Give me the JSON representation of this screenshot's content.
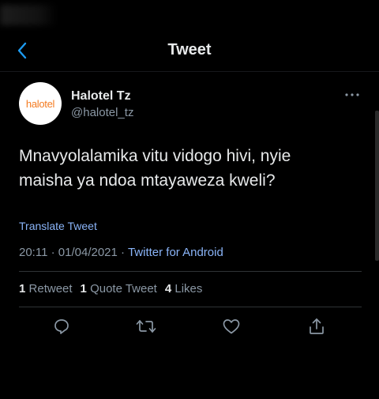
{
  "header": {
    "title": "Tweet",
    "back_icon": "chevron-left-icon"
  },
  "tweet": {
    "avatar_logo": "halotel",
    "display_name": "Halotel Tz",
    "handle": "@halotel_tz",
    "more_icon": "more-horizontal-icon",
    "text": "Mnavyolalamika vitu vidogo hivi, nyie\nmaisha ya ndoa mtayaweza kweli?",
    "translate_label": "Translate Tweet",
    "time": "20:11",
    "date": "01/04/2021",
    "separator": "·",
    "source": "Twitter for Android"
  },
  "stats": {
    "retweets_count": "1",
    "retweets_label": "Retweet",
    "quotes_count": "1",
    "quotes_label": "Quote Tweet",
    "likes_count": "4",
    "likes_label": "Likes"
  },
  "actions": [
    {
      "name": "reply",
      "icon": "reply-icon"
    },
    {
      "name": "retweet",
      "icon": "retweet-icon"
    },
    {
      "name": "like",
      "icon": "heart-icon"
    },
    {
      "name": "share",
      "icon": "share-icon"
    }
  ],
  "colors": {
    "background": "#000000",
    "text_primary": "#e7e9ea",
    "text_secondary": "#8b98a5",
    "link": "#8ab4f8",
    "accent": "#1d9bf0",
    "brand_orange": "#f47b20"
  }
}
